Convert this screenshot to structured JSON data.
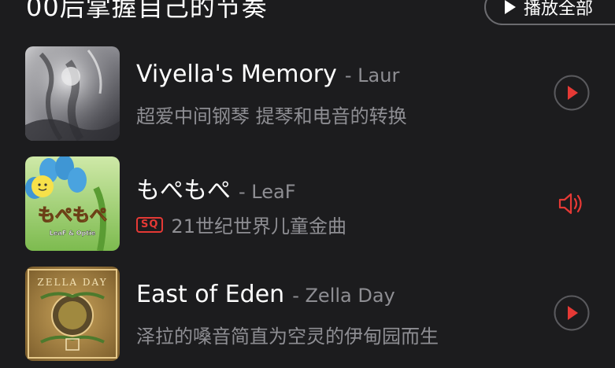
{
  "section": {
    "title": "00后掌握自己的节奏",
    "play_all_label": "播放全部"
  },
  "songs": [
    {
      "title": "Viyella's Memory",
      "artist": "- Laur",
      "subtitle": "超爱中间钢琴 提琴和电音的转换",
      "badge": "",
      "state": "play"
    },
    {
      "title": "もぺもぺ",
      "artist": "- LeaF",
      "subtitle": "21世纪世界儿童金曲",
      "badge": "SQ",
      "state": "playing"
    },
    {
      "title": "East of Eden",
      "artist": "- Zella Day",
      "subtitle": "泽拉的嗓音简直为空灵的伊甸园而生",
      "badge": "",
      "state": "play"
    }
  ],
  "colors": {
    "background": "#1c1c1e",
    "accent": "#e53935",
    "secondary_text": "#8e8e93"
  }
}
